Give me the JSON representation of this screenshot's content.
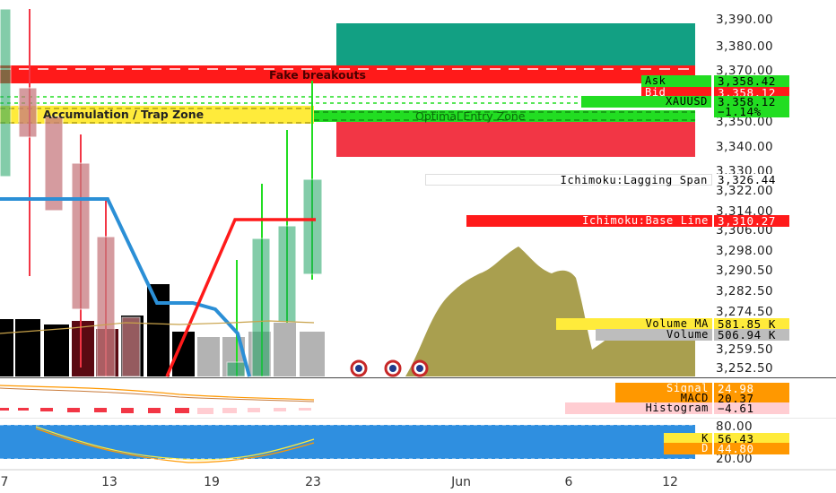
{
  "price_axis": {
    "labels": [
      "3,390.00",
      "3,380.00",
      "3,370.00",
      "3,350.00",
      "3,340.00",
      "3,330.00",
      "3,322.00",
      "3,314.00",
      "3,306.00",
      "3,298.00",
      "3,290.50",
      "3,282.50",
      "3,274.50",
      "3,259.50",
      "3,252.50"
    ],
    "stoch_labels": [
      "80.00",
      "20.00"
    ]
  },
  "date_axis": [
    "7",
    "13",
    "19",
    "23",
    "Jun",
    "6",
    "12"
  ],
  "zones": {
    "fake_breakouts": "Fake breakouts",
    "accumulation": "Accumulation / Trap Zone",
    "optimal_entry": "Optimal Entry Zone"
  },
  "price_tags": [
    {
      "label": "Ask",
      "value": "3,358.42",
      "color": "#22dd22"
    },
    {
      "label": "Bid",
      "value": "3,358.12",
      "color": "#ff1a1a"
    },
    {
      "label": "XAUUSD",
      "value": "3,358.12",
      "value2": "−1.14%",
      "color": "#22dd22"
    }
  ],
  "indicator_tags": [
    {
      "label": "Ichimoku:Lagging Span",
      "value": "3,326.44"
    },
    {
      "label": "Ichimoku:Base Line",
      "value": "3,310.27"
    },
    {
      "label": "Volume MA",
      "value": "581.85 K"
    },
    {
      "label": "Volume",
      "value": "506.94 K"
    },
    {
      "label": "Signal",
      "value": "24.98"
    },
    {
      "label": "MACD",
      "value": "20.37"
    },
    {
      "label": "Histogram",
      "value": "−4.61"
    },
    {
      "label": "K",
      "value": "56.43"
    },
    {
      "label": "D",
      "value": "44.80"
    }
  ],
  "colors": {
    "bull": "#1fa463",
    "bear": "#f23645",
    "yellow": "#ffeb3b",
    "orange": "#ff9800",
    "pink": "#ffcdd2",
    "gray": "#9e9e9e",
    "blue": "#1e88e5",
    "olive": "#a49a46"
  }
}
